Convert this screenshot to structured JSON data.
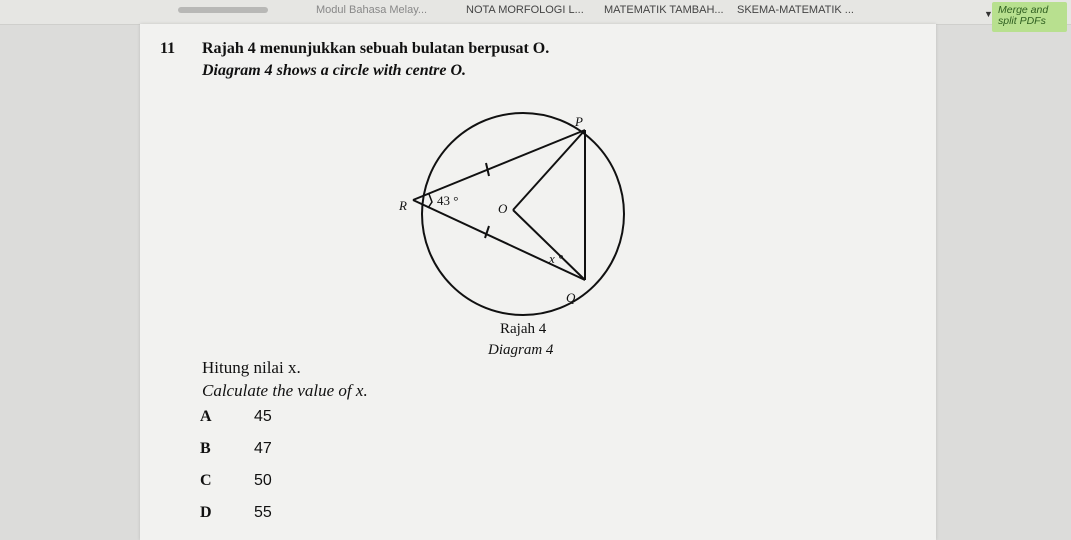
{
  "tabs": [
    {
      "label": "Modul Bahasa Melay..."
    },
    {
      "label": "NOTA MORFOLOGI L..."
    },
    {
      "label": "MATEMATIK TAMBAH..."
    },
    {
      "label": "SKEMA-MATEMATIK ..."
    }
  ],
  "merge_button": {
    "line1": "Merge and",
    "line2": "split PDFs"
  },
  "question": {
    "number": "11",
    "stem_ms": "Rajah 4 menunjukkan sebuah bulatan berpusat O.",
    "stem_en": "Diagram 4 shows a circle with centre O.",
    "ask_ms": "Hitung nilai x.",
    "ask_en": "Calculate the value of x."
  },
  "diagram": {
    "labels": {
      "P": "P",
      "R": "R",
      "O_centre": "O",
      "Q": "Q",
      "angle": "43 °",
      "x": "x °"
    },
    "caption_ms": "Rajah 4",
    "caption_en": "Diagram 4"
  },
  "options": [
    {
      "letter": "A",
      "value": "45"
    },
    {
      "letter": "B",
      "value": "47"
    },
    {
      "letter": "C",
      "value": "50"
    },
    {
      "letter": "D",
      "value": "55"
    }
  ]
}
